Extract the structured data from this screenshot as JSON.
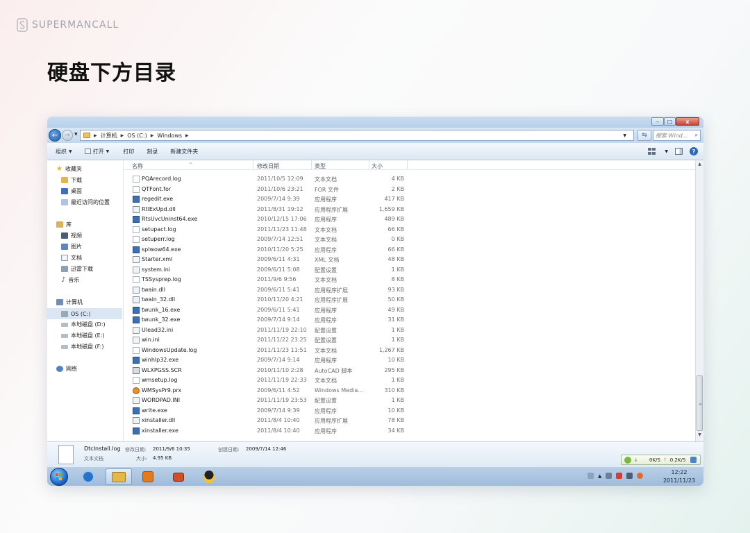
{
  "brand": {
    "name": "SUPERMANCALL"
  },
  "page": {
    "title": "硬盘下方目录"
  },
  "window": {
    "controls": {
      "minimize": "–",
      "maximize": "□",
      "close": "x"
    },
    "address": {
      "crumbs": [
        "计算机",
        "OS (C:)",
        "Windows"
      ]
    },
    "search": {
      "placeholder": "搜索 Wind..."
    },
    "toolbar": {
      "organize": "组织",
      "open": "打开",
      "print": "打印",
      "burn": "刻录",
      "new_folder": "新建文件夹"
    },
    "nav": {
      "favorites": "收藏夹",
      "downloads": "下载",
      "desktop": "桌面",
      "recent": "最近访问的位置",
      "libraries": "库",
      "videos": "视频",
      "pictures": "图片",
      "documents": "文档",
      "xunlei": "迅雷下载",
      "music": "音乐",
      "computer": "计算机",
      "os_c": "OS (C:)",
      "disk_d": "本地磁盘 (D:)",
      "disk_e": "本地磁盘 (E:)",
      "disk_f": "本地磁盘 (F:)",
      "network": "网络"
    },
    "columns": {
      "name": "名称",
      "date": "修改日期",
      "type": "类型",
      "size": "大小"
    },
    "files": [
      {
        "name": "PQArecord.log",
        "date": "2011/10/5 12:09",
        "type": "文本文档",
        "size": "4 KB",
        "icon": "log"
      },
      {
        "name": "QTFont.for",
        "date": "2011/10/6 23:21",
        "type": "FOR 文件",
        "size": "2 KB",
        "icon": "log"
      },
      {
        "name": "regedit.exe",
        "date": "2009/7/14 9:39",
        "type": "应用程序",
        "size": "417 KB",
        "icon": "exe"
      },
      {
        "name": "RtlExUpd.dll",
        "date": "2011/8/31 19:12",
        "type": "应用程序扩展",
        "size": "1,659 KB",
        "icon": "dll"
      },
      {
        "name": "RtsUvcUninst64.exe",
        "date": "2010/12/15 17:06",
        "type": "应用程序",
        "size": "489 KB",
        "icon": "exe"
      },
      {
        "name": "setupact.log",
        "date": "2011/11/23 11:48",
        "type": "文本文档",
        "size": "66 KB",
        "icon": "log"
      },
      {
        "name": "setuperr.log",
        "date": "2009/7/14 12:51",
        "type": "文本文档",
        "size": "0 KB",
        "icon": "log"
      },
      {
        "name": "splwow64.exe",
        "date": "2010/11/20 5:25",
        "type": "应用程序",
        "size": "66 KB",
        "icon": "exe"
      },
      {
        "name": "Starter.xml",
        "date": "2009/6/11 4:31",
        "type": "XML 文档",
        "size": "48 KB",
        "icon": "xml"
      },
      {
        "name": "system.ini",
        "date": "2009/6/11 5:08",
        "type": "配置设置",
        "size": "1 KB",
        "icon": "ini"
      },
      {
        "name": "TSSysprep.log",
        "date": "2011/9/6 9:56",
        "type": "文本文档",
        "size": "8 KB",
        "icon": "log"
      },
      {
        "name": "twain.dll",
        "date": "2009/6/11 5:41",
        "type": "应用程序扩展",
        "size": "93 KB",
        "icon": "dll"
      },
      {
        "name": "twain_32.dll",
        "date": "2010/11/20 4:21",
        "type": "应用程序扩展",
        "size": "50 KB",
        "icon": "dll"
      },
      {
        "name": "twunk_16.exe",
        "date": "2009/6/11 5:41",
        "type": "应用程序",
        "size": "49 KB",
        "icon": "exe"
      },
      {
        "name": "twunk_32.exe",
        "date": "2009/7/14 9:14",
        "type": "应用程序",
        "size": "31 KB",
        "icon": "exe"
      },
      {
        "name": "Ulead32.ini",
        "date": "2011/11/19 22:10",
        "type": "配置设置",
        "size": "1 KB",
        "icon": "ini"
      },
      {
        "name": "win.ini",
        "date": "2011/11/22 23:25",
        "type": "配置设置",
        "size": "1 KB",
        "icon": "ini"
      },
      {
        "name": "WindowsUpdate.log",
        "date": "2011/11/23 11:51",
        "type": "文本文档",
        "size": "1,267 KB",
        "icon": "log"
      },
      {
        "name": "winhlp32.exe",
        "date": "2009/7/14 9:14",
        "type": "应用程序",
        "size": "10 KB",
        "icon": "exe"
      },
      {
        "name": "WLXPGSS.SCR",
        "date": "2010/11/10 2:28",
        "type": "AutoCAD 脚本",
        "size": "295 KB",
        "icon": "scr"
      },
      {
        "name": "wmsetup.log",
        "date": "2011/11/19 22:33",
        "type": "文本文档",
        "size": "1 KB",
        "icon": "log"
      },
      {
        "name": "WMSysPr9.prx",
        "date": "2009/6/11 4:52",
        "type": "Windows Media...",
        "size": "310 KB",
        "icon": "prx"
      },
      {
        "name": "WORDPAD.INI",
        "date": "2011/11/19 23:53",
        "type": "配置设置",
        "size": "1 KB",
        "icon": "ini"
      },
      {
        "name": "write.exe",
        "date": "2009/7/14 9:39",
        "type": "应用程序",
        "size": "10 KB",
        "icon": "exe"
      },
      {
        "name": "xinstaller.dll",
        "date": "2011/8/4 10:40",
        "type": "应用程序扩展",
        "size": "78 KB",
        "icon": "dll"
      },
      {
        "name": "xinstaller.exe",
        "date": "2011/8/4 10:40",
        "type": "应用程序",
        "size": "34 KB",
        "icon": "exe"
      }
    ],
    "details": {
      "filename": "DtcInstall.log",
      "modified_label": "修改日期:",
      "modified_value": "2011/9/6 10:35",
      "created_label": "创建日期:",
      "created_value": "2009/7/14 12:46",
      "type": "文本文档",
      "size_label": "大小:",
      "size_value": "4.95 KB"
    },
    "speed": {
      "down": "0K/S",
      "up": "0.2K/S"
    },
    "clock": {
      "time": "12:22",
      "date": "2011/11/23"
    }
  },
  "colors": {
    "accent": "#1f6bc9",
    "title_text": "#111111",
    "brand_text": "#a2a6ac"
  }
}
